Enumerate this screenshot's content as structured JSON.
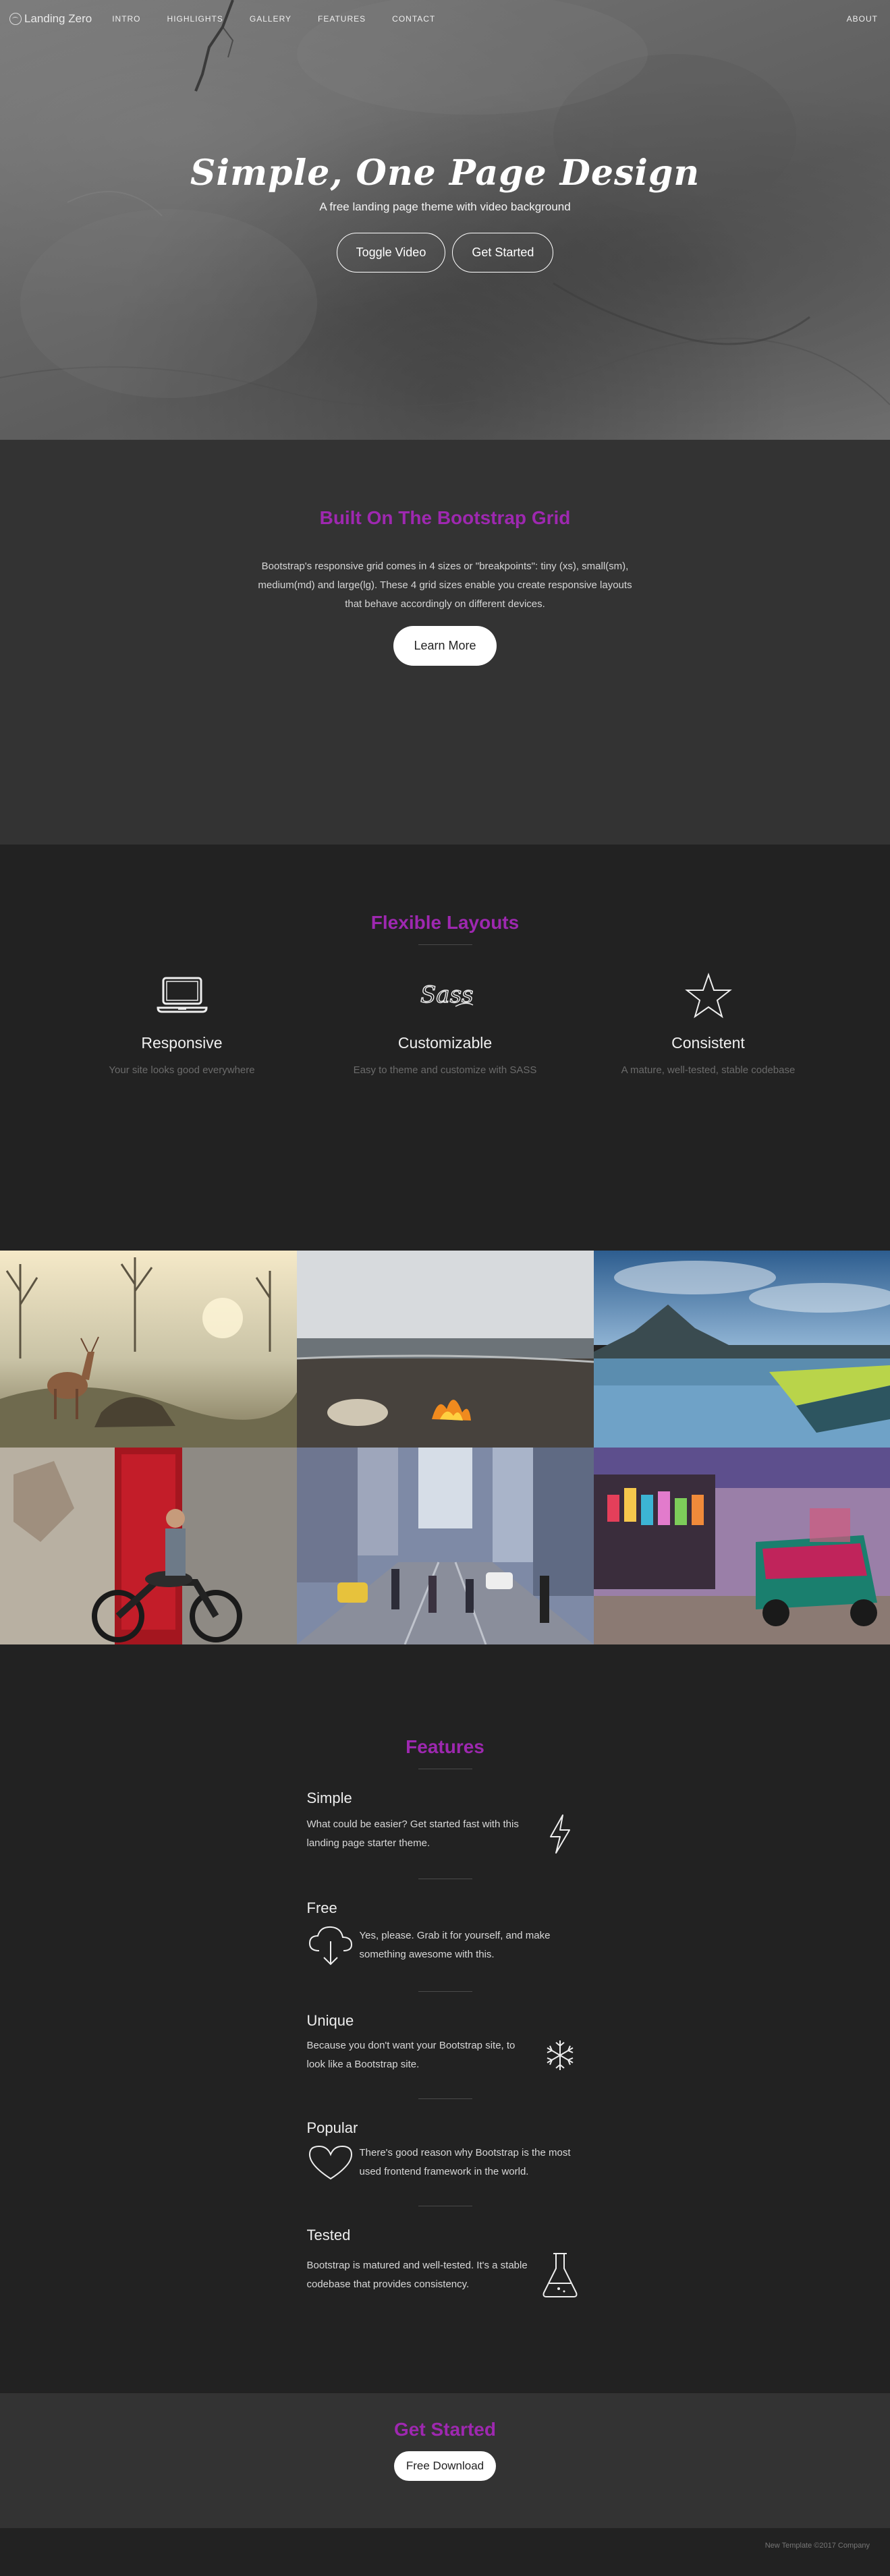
{
  "nav": {
    "brand": "Landing Zero",
    "links": [
      "INTRO",
      "HIGHLIGHTS",
      "GALLERY",
      "FEATURES",
      "CONTACT"
    ],
    "right_link": "ABOUT"
  },
  "hero": {
    "title": "Simple, One Page Design",
    "subtitle": "A free landing page theme with video background",
    "btn_toggle": "Toggle Video",
    "btn_start": "Get Started"
  },
  "intro": {
    "title": "Built On The Bootstrap Grid",
    "text": "Bootstrap's responsive grid comes in 4 sizes or \"breakpoints\": tiny (xs), small(sm), medium(md) and large(lg). These 4 grid sizes enable you create responsive layouts that behave accordingly on different devices.",
    "button": "Learn More"
  },
  "layouts": {
    "title": "Flexible Layouts",
    "items": [
      {
        "icon": "laptop-icon",
        "title": "Responsive",
        "desc": "Your site looks good everywhere"
      },
      {
        "icon": "sass-logo-icon",
        "title": "Customizable",
        "desc": "Easy to theme and customize with SASS"
      },
      {
        "icon": "star-icon",
        "title": "Consistent",
        "desc": "A mature, well-tested, stable codebase"
      }
    ]
  },
  "gallery": {
    "tiles": [
      "deer-photo",
      "beach-fire-photo",
      "lake-pier-photo",
      "motorcycle-photo",
      "city-street-photo",
      "rickshaw-photo"
    ]
  },
  "features": {
    "title": "Features",
    "items": [
      {
        "name": "Simple",
        "text": "What could be easier? Get started fast with this landing page starter theme.",
        "icon": "lightning-icon"
      },
      {
        "name": "Free",
        "text": "Yes, please. Grab it for yourself, and make something awesome with this.",
        "icon": "cloud-download-icon"
      },
      {
        "name": "Unique",
        "text": "Because you don't want your Bootstrap site, to look like a Bootstrap site.",
        "icon": "snowflake-icon"
      },
      {
        "name": "Popular",
        "text": "There's good reason why Bootstrap is the most used frontend framework in the world.",
        "icon": "heart-icon"
      },
      {
        "name": "Tested",
        "text": "Bootstrap is matured and well-tested. It's a stable codebase that provides consistency.",
        "icon": "flask-icon"
      }
    ]
  },
  "get_started": {
    "title": "Get Started",
    "button": "Free Download"
  },
  "footer": {
    "text": "New Template ©2017 Company"
  },
  "colors": {
    "accent": "#9e28b0",
    "dark_bg": "#222222",
    "section_bg": "#333333"
  }
}
